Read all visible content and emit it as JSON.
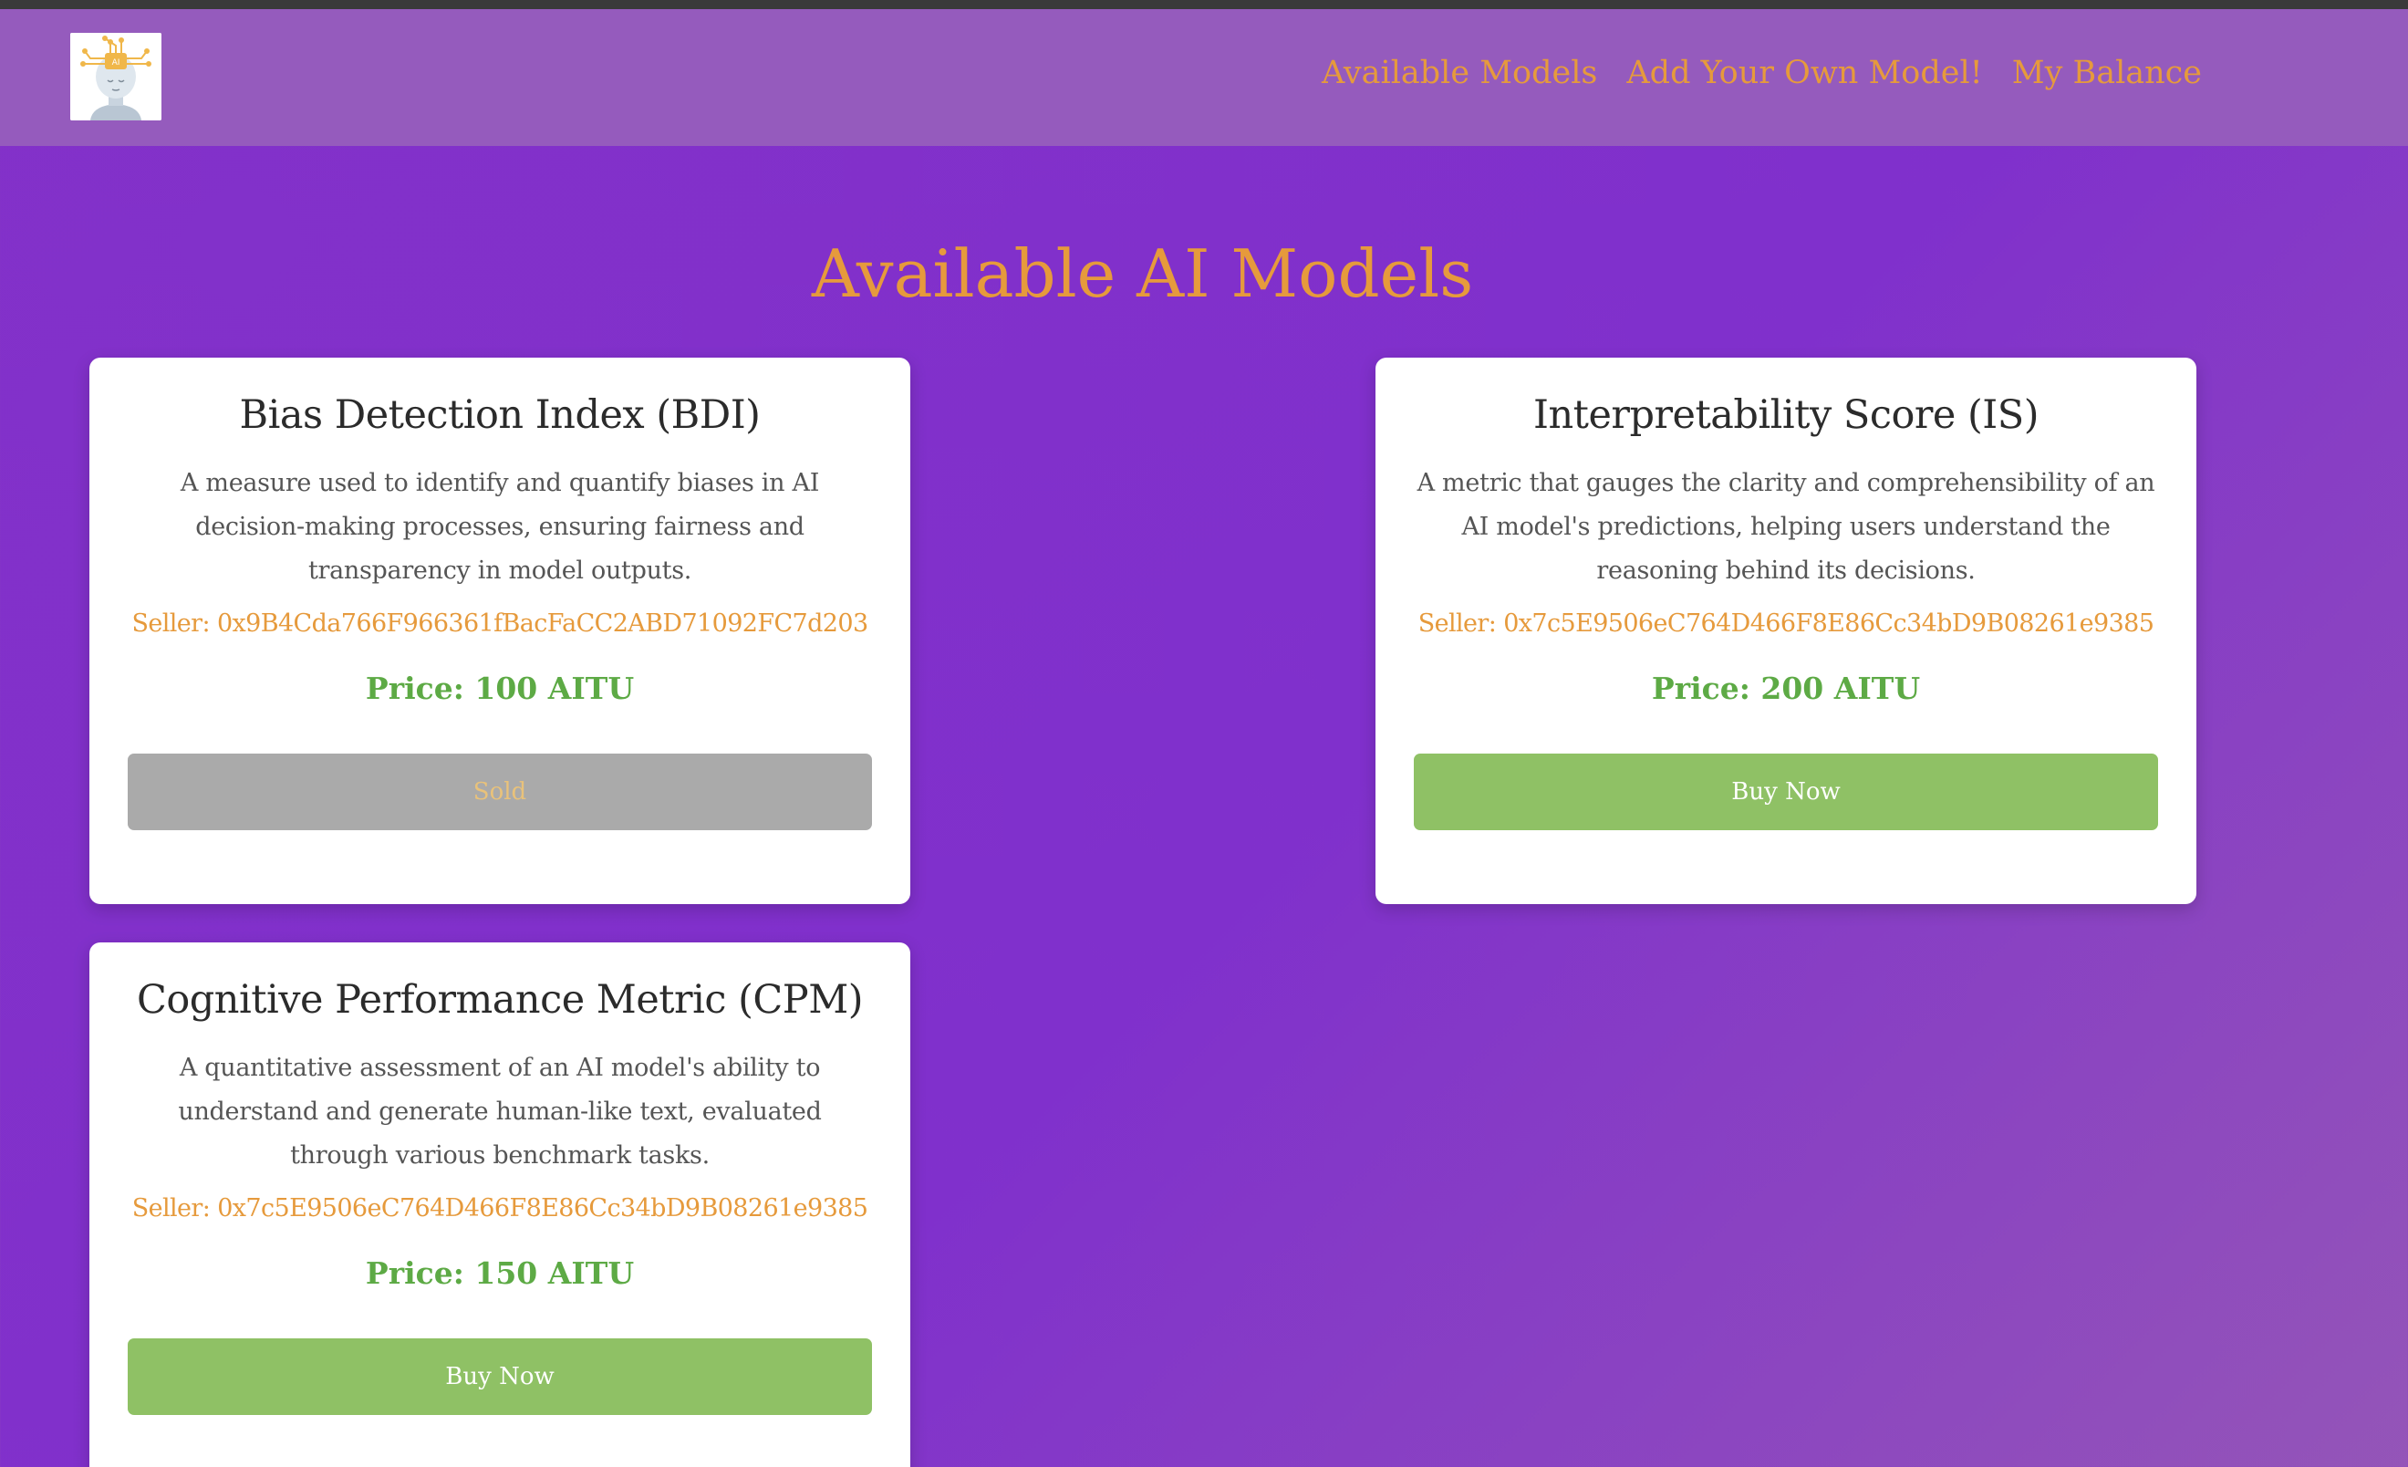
{
  "nav": {
    "logo_alt": "AI head logo",
    "links": [
      "Available Models",
      "Add Your Own Model!",
      "My Balance"
    ]
  },
  "page": {
    "title": "Available AI Models"
  },
  "cards": [
    {
      "title": "Bias Detection Index (BDI)",
      "description": "A measure used to identify and quantify biases in AI decision-making processes, ensuring fairness and transparency in model outputs.",
      "seller": "Seller: 0x9B4Cda766F966361fBacFaCC2ABD71092FC7d203",
      "price": "Price: 100 AITU",
      "button": "Sold",
      "status": "sold"
    },
    {
      "title": "Interpretability Score (IS)",
      "description": "A metric that gauges the clarity and comprehensibility of an AI model's predictions, helping users understand the reasoning behind its decisions.",
      "seller": "Seller: 0x7c5E9506eC764D466F8E86Cc34bD9B08261e9385",
      "price": "Price: 200 AITU",
      "button": "Buy Now",
      "status": "available"
    },
    {
      "title": "Cognitive Performance Metric (CPM)",
      "description": "A quantitative assessment of an AI model's ability to understand and generate human-like text, evaluated through various benchmark tasks.",
      "seller": "Seller: 0x7c5E9506eC764D466F8E86Cc34bD9B08261e9385",
      "price": "Price: 150 AITU",
      "button": "Buy Now",
      "status": "available"
    }
  ],
  "colors": {
    "accent": "#e69a3c",
    "price": "#5daa45",
    "buy_button": "#8fc165",
    "sold_button": "#aaaaaa",
    "navbar": "#955bbd",
    "background": "#8331c9"
  }
}
